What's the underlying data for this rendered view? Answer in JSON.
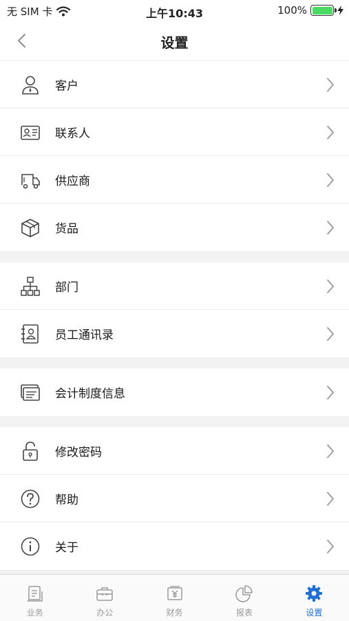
{
  "status": {
    "carrier": "无 SIM 卡",
    "time": "上午10:43",
    "battery": "100%",
    "battery_level": 1.0,
    "wifi_icon": "wifi-icon",
    "charging_icon": "charging-bolt-icon"
  },
  "nav": {
    "title": "设置",
    "back_icon": "back-chevron-icon"
  },
  "groups": [
    {
      "items": [
        {
          "label": "客户",
          "icon": "customer-icon"
        },
        {
          "label": "联系人",
          "icon": "contact-card-icon"
        },
        {
          "label": "供应商",
          "icon": "truck-icon"
        },
        {
          "label": "货品",
          "icon": "package-icon"
        }
      ]
    },
    {
      "items": [
        {
          "label": "部门",
          "icon": "org-chart-icon"
        },
        {
          "label": "员工通讯录",
          "icon": "address-book-icon"
        }
      ]
    },
    {
      "items": [
        {
          "label": "会计制度信息",
          "icon": "accounting-docs-icon"
        }
      ]
    },
    {
      "items": [
        {
          "label": "修改密码",
          "icon": "lock-icon"
        },
        {
          "label": "帮助",
          "icon": "help-icon"
        },
        {
          "label": "关于",
          "icon": "info-icon"
        }
      ]
    }
  ],
  "tabs": [
    {
      "label": "业务",
      "icon": "business-doc-icon",
      "active": false
    },
    {
      "label": "办公",
      "icon": "briefcase-icon",
      "active": false
    },
    {
      "label": "财务",
      "icon": "finance-yen-icon",
      "active": false
    },
    {
      "label": "报表",
      "icon": "pie-chart-icon",
      "active": false
    },
    {
      "label": "设置",
      "icon": "gear-icon",
      "active": true
    }
  ],
  "colors": {
    "accent": "#1e6fd6",
    "inactive": "#9a9a9a",
    "battery": "#4cd964"
  }
}
